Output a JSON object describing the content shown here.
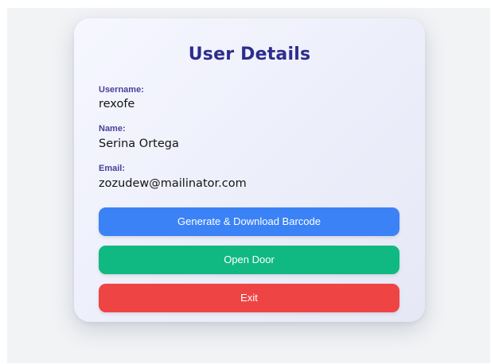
{
  "card": {
    "title": "User Details"
  },
  "fields": {
    "username": {
      "label": "Username:",
      "value": "rexofe"
    },
    "name": {
      "label": "Name:",
      "value": "Serina Ortega"
    },
    "email": {
      "label": "Email:",
      "value": "zozudew@mailinator.com"
    }
  },
  "buttons": {
    "barcode": {
      "label": "Generate & Download Barcode",
      "color": "#3b82f6"
    },
    "open_door": {
      "label": "Open Door",
      "color": "#10b981"
    },
    "exit": {
      "label": "Exit",
      "color": "#ef4444"
    }
  },
  "theme": {
    "title_color": "#2c2d8c",
    "label_color": "#4a3f9a"
  }
}
